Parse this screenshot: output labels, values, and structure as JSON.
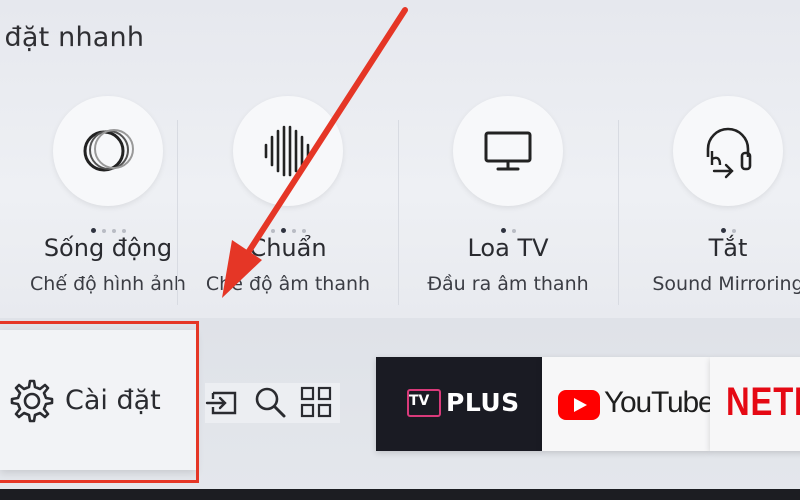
{
  "quick_settings": {
    "title": "i đặt nhanh",
    "items": [
      {
        "value": "Sống động",
        "subtitle": "Chế độ hình ảnh",
        "icon": "picture-mode-icon"
      },
      {
        "value": "Chuẩn",
        "subtitle": "Chế độ âm thanh",
        "icon": "sound-mode-icon"
      },
      {
        "value": "Loa TV",
        "subtitle": "Đầu ra âm thanh",
        "icon": "tv-speaker-icon"
      },
      {
        "value": "Tắt",
        "subtitle": "Sound Mirroring",
        "icon": "headphone-icon"
      }
    ]
  },
  "bottom_bar": {
    "settings_label": "Cài đặt",
    "shortcuts": [
      "source-icon",
      "search-icon",
      "apps-grid-icon"
    ],
    "apps": [
      {
        "name": "TV PLUS",
        "badge": "TV",
        "text": "PLUS",
        "color": "#1a1b23"
      },
      {
        "name": "YouTube",
        "text": "YouTube",
        "color": "#ff0000"
      },
      {
        "name": "NETFLIX",
        "text": "NETF",
        "color": "#e50914"
      }
    ]
  },
  "annotation": {
    "arrow_color": "#e53626",
    "highlight_color": "#e53626"
  }
}
